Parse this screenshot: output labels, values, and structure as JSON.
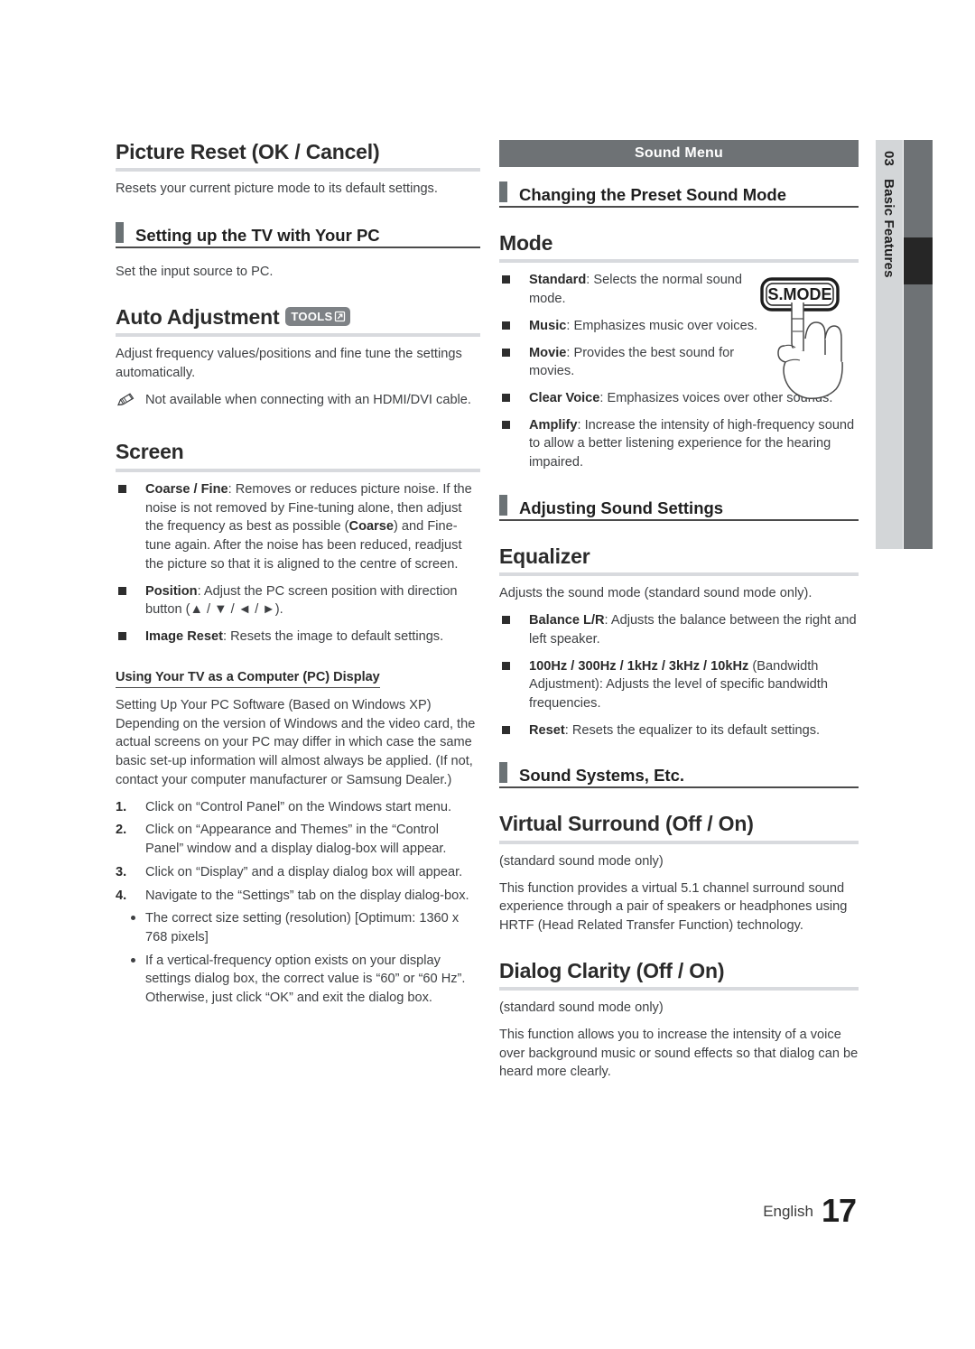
{
  "page": {
    "chapter_number": "03",
    "chapter_title": "Basic Features",
    "footer_language": "English",
    "footer_page_number": "17",
    "colors": {
      "rule": "#d8dade",
      "accent_gray": "#6e7275",
      "tab_light": "#d3d6d8",
      "marker_dark": "#262626"
    }
  },
  "left_column": {
    "picture_reset": {
      "heading": "Picture Reset (OK / Cancel)",
      "body": "Resets your current picture mode to its default settings."
    },
    "setting_up_pc": {
      "subhead": "Setting up the TV with Your PC",
      "body": "Set the input source to PC."
    },
    "auto_adjustment": {
      "heading": "Auto Adjustment",
      "badge_label": "TOOLS",
      "body": "Adjust frequency values/positions and fine tune the settings automatically.",
      "note": "Not available when connecting with an HDMI/DVI cable."
    },
    "screen": {
      "heading": "Screen",
      "items": [
        {
          "term": "Coarse / Fine",
          "text_1": ": Removes or reduces picture noise. If the noise is not removed by Fine-tuning alone, then adjust the frequency as best as possible (",
          "term_2": "Coarse",
          "text_2": ") and Fine-tune again. After the noise has been reduced, readjust the picture so that it is aligned to the centre of screen."
        },
        {
          "term": "Position",
          "text_1": ": Adjust the PC screen position with direction button (▲ / ▼ / ◄ / ►)."
        },
        {
          "term": "Image Reset",
          "text_1": ": Resets the image to default settings."
        }
      ]
    },
    "pc_display": {
      "mini_heading": "Using Your TV as a Computer (PC) Display",
      "intro": "Setting Up Your PC Software (Based on Windows XP) Depending on the version of Windows and the video card, the actual screens on your PC may differ in which case the same basic set-up information will almost always be applied. (If not, contact your computer manufacturer or Samsung Dealer.)",
      "steps": [
        {
          "num": "1.",
          "text": "Click on “Control Panel” on the Windows start menu."
        },
        {
          "num": "2.",
          "text": "Click on “Appearance and Themes” in the “Control Panel” window and a display dialog-box will appear."
        },
        {
          "num": "3.",
          "text": "Click on “Display” and a display dialog box will appear."
        },
        {
          "num": "4.",
          "text": "Navigate to the “Settings” tab on the display dialog-box."
        }
      ],
      "bullets": [
        "The correct size setting (resolution) [Optimum: 1360 x 768 pixels]",
        "If a vertical-frequency option exists on your display settings dialog box, the correct value is “60” or “60 Hz”. Otherwise, just click “OK” and exit the dialog box."
      ]
    }
  },
  "right_column": {
    "menu_bar_title": "Sound Menu",
    "preset_sound": {
      "subhead": "Changing the Preset Sound Mode",
      "heading": "Mode",
      "button_label": "S.MODE",
      "items": [
        {
          "term": "Standard",
          "text": ": Selects the normal sound mode."
        },
        {
          "term": "Music",
          "text": ": Emphasizes music over voices."
        },
        {
          "term": "Movie",
          "text": ": Provides the best sound for movies."
        },
        {
          "term": "Clear Voice",
          "text": ": Emphasizes voices over other sounds."
        },
        {
          "term": "Amplify",
          "text": ": Increase the intensity of high-frequency sound to allow a better listening experience for the hearing impaired."
        }
      ]
    },
    "adjusting_sound": {
      "subhead": "Adjusting Sound Settings",
      "equalizer": {
        "heading": "Equalizer",
        "body": "Adjusts the sound mode (standard sound mode only).",
        "items": [
          {
            "term": "Balance L/R",
            "text": ": Adjusts the balance between the right and left speaker."
          },
          {
            "term": "100Hz / 300Hz / 1kHz / 3kHz / 10kHz",
            "text": " (Bandwidth Adjustment): Adjusts the level of specific bandwidth frequencies."
          },
          {
            "term": "Reset",
            "text": ": Resets the equalizer to its default settings."
          }
        ]
      }
    },
    "sound_systems": {
      "subhead": "Sound Systems, Etc.",
      "virtual_surround": {
        "heading": "Virtual Surround (Off / On)",
        "note": "(standard sound mode only)",
        "body": "This function provides a virtual 5.1 channel surround sound experience through a pair of speakers or headphones using HRTF (Head Related Transfer Function) technology."
      },
      "dialog_clarity": {
        "heading": "Dialog Clarity (Off / On)",
        "note": "(standard sound mode only)",
        "body": "This function allows you to increase the intensity of a voice over background music or sound effects so that dialog can be heard more clearly."
      }
    }
  }
}
